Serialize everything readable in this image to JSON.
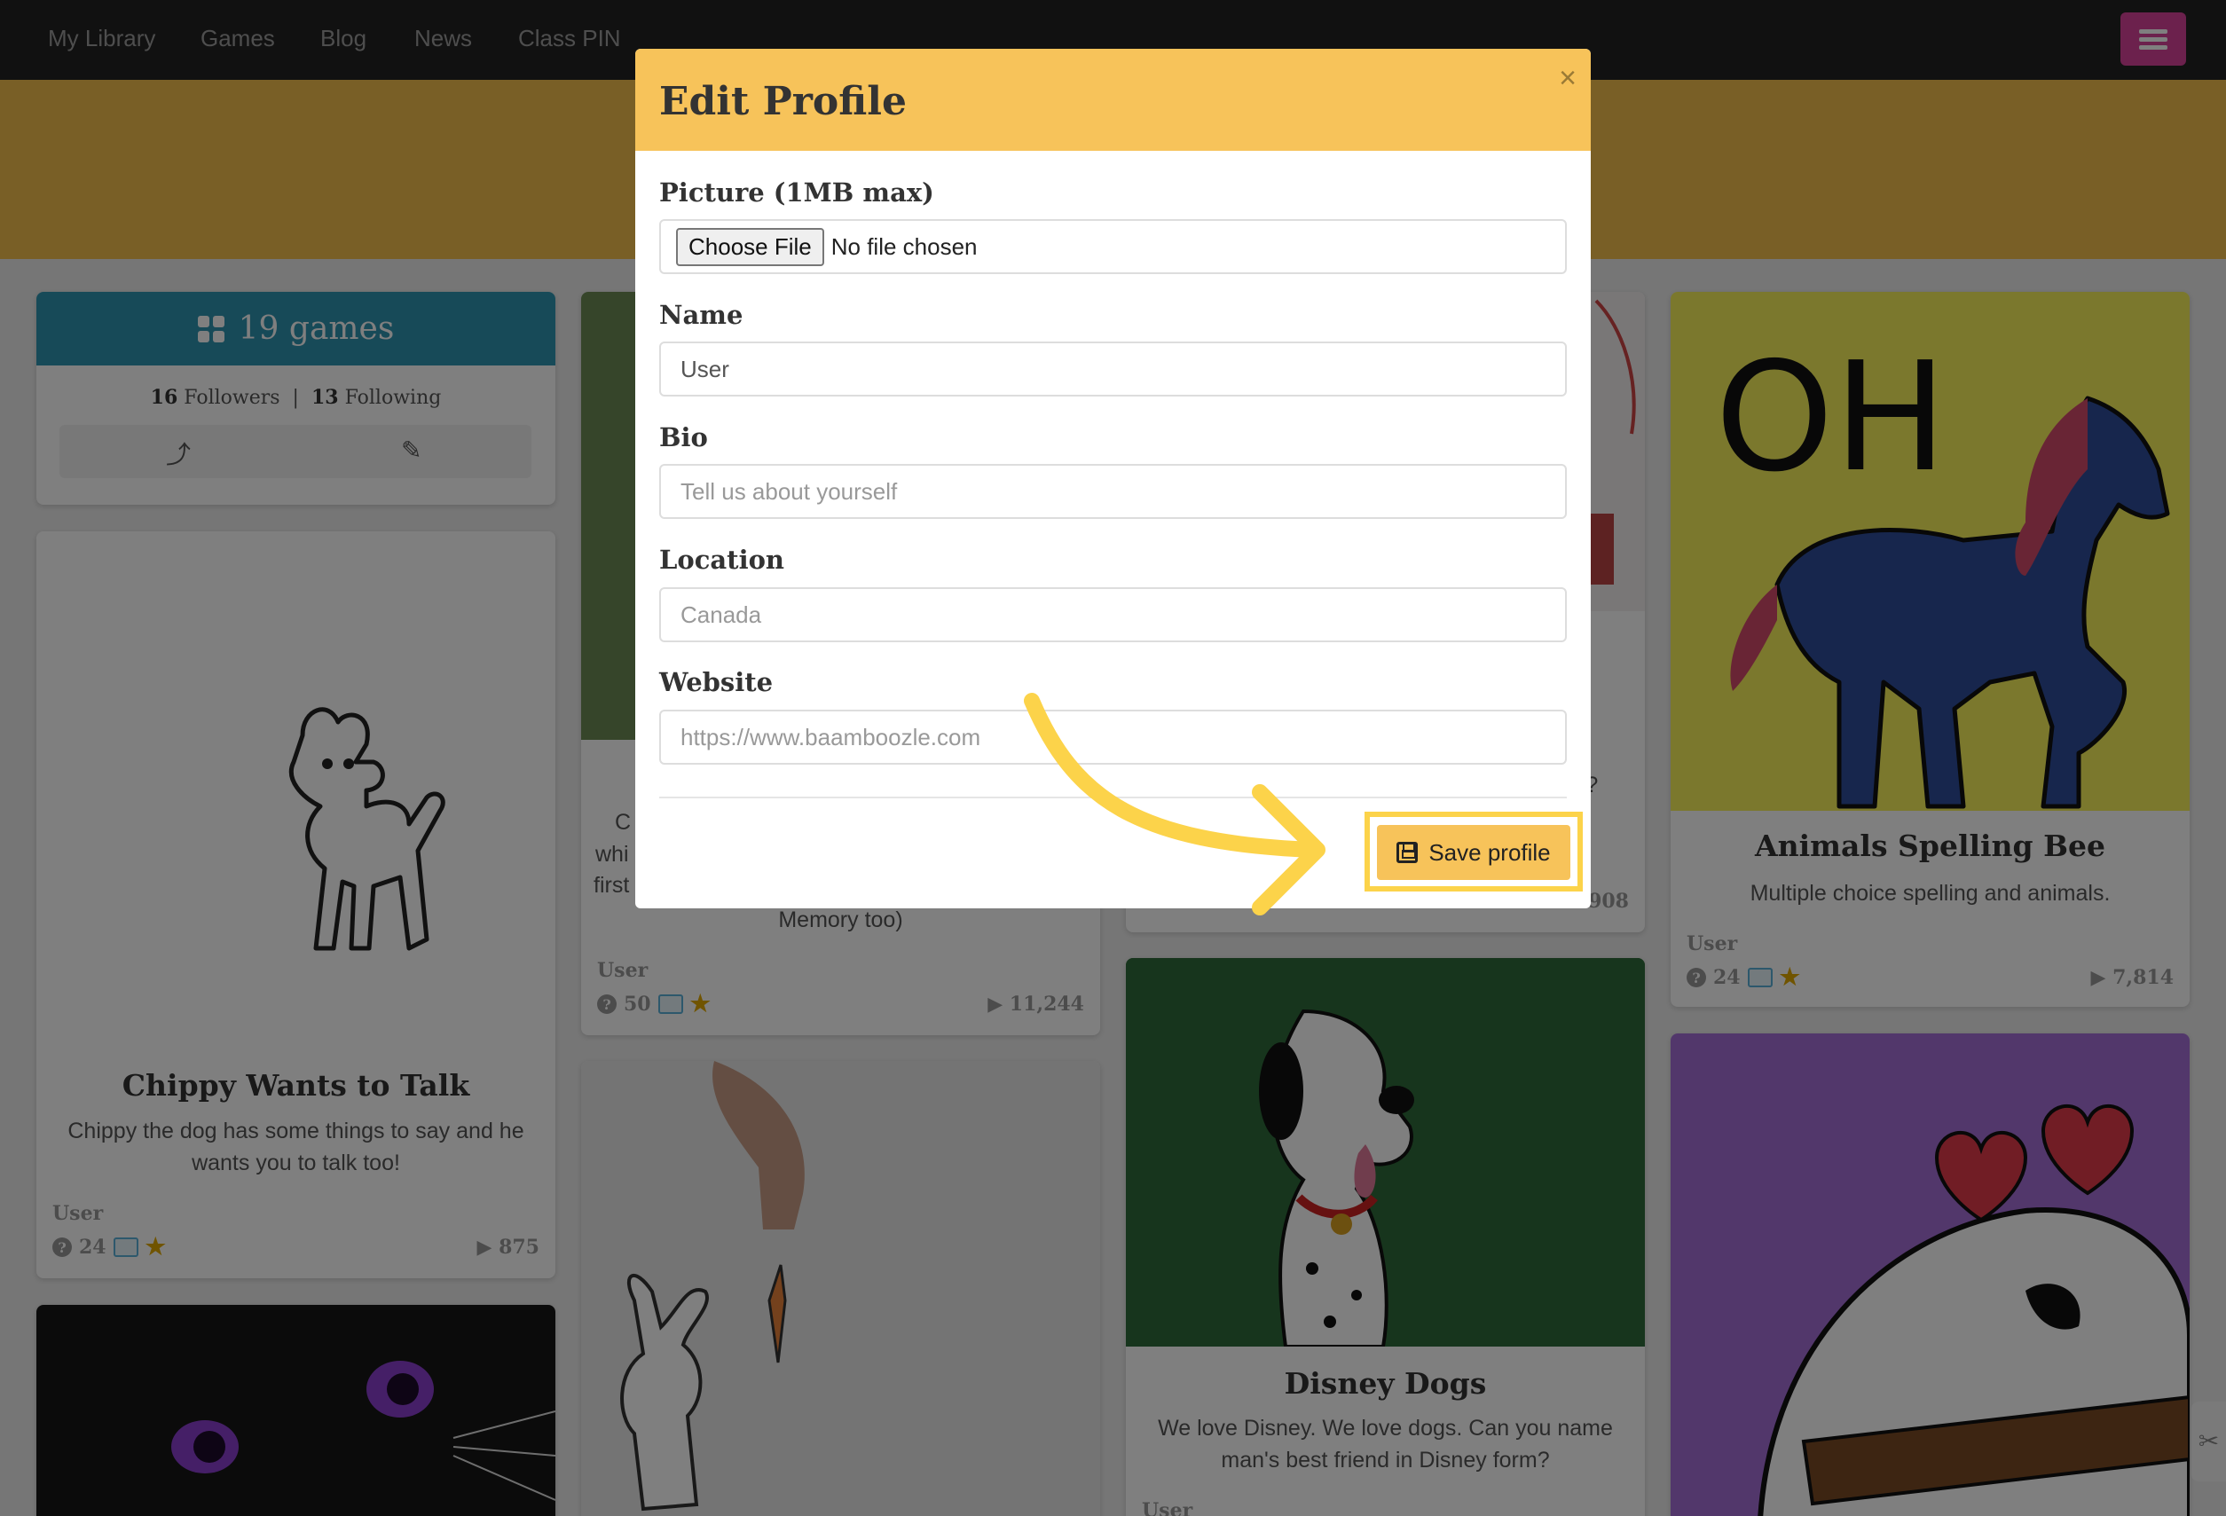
{
  "navbar": {
    "items": [
      "My Library",
      "Games",
      "Blog",
      "News",
      "Class PIN"
    ],
    "menu_icon": "hamburger-icon"
  },
  "profile_stats": {
    "games_label": "19 games",
    "followers_count": "16",
    "followers_label": "Followers",
    "following_count": "13",
    "following_label": "Following",
    "share_icon": "share-icon",
    "edit_icon": "pencil-icon"
  },
  "cards": [
    {
      "title": "Chippy Wants to Talk",
      "desc": "Chippy the dog has some things to say and he wants you to talk too!",
      "user": "User",
      "questions": "24",
      "plays": "875"
    },
    {
      "title": "",
      "desc_fragments": [
        "C",
        "whi",
        "first",
        "Memory too)"
      ],
      "user": "User",
      "questions": "50",
      "plays": "11,244"
    },
    {
      "title": "",
      "desc_fragments": [
        "r?"
      ],
      "plays_fragment": "908"
    },
    {
      "title": "Animals Spelling Bee",
      "desc": "Multiple choice spelling and animals.",
      "user": "User",
      "questions": "24",
      "plays": "7,814"
    },
    {
      "title": "Disney Dogs",
      "desc": "We love Disney. We love dogs. Can you name man's best friend in Disney form?",
      "user": "User"
    }
  ],
  "modal": {
    "title": "Edit Profile",
    "close": "×",
    "picture_label": "Picture (1MB max)",
    "file_button": "Choose File",
    "file_status": "No file chosen",
    "name_label": "Name",
    "name_value": "User",
    "bio_label": "Bio",
    "bio_placeholder": "Tell us about yourself",
    "location_label": "Location",
    "location_placeholder": "Canada",
    "website_label": "Website",
    "website_placeholder": "https://www.baamboozle.com",
    "save_button": "Save profile"
  },
  "colors": {
    "navbar": "#222222",
    "banner": "#f2bf4d",
    "stats_header": "#2f94b0",
    "modal_header": "#f7c35a",
    "highlight": "#fcd34a",
    "menu_button": "#d9439a"
  }
}
